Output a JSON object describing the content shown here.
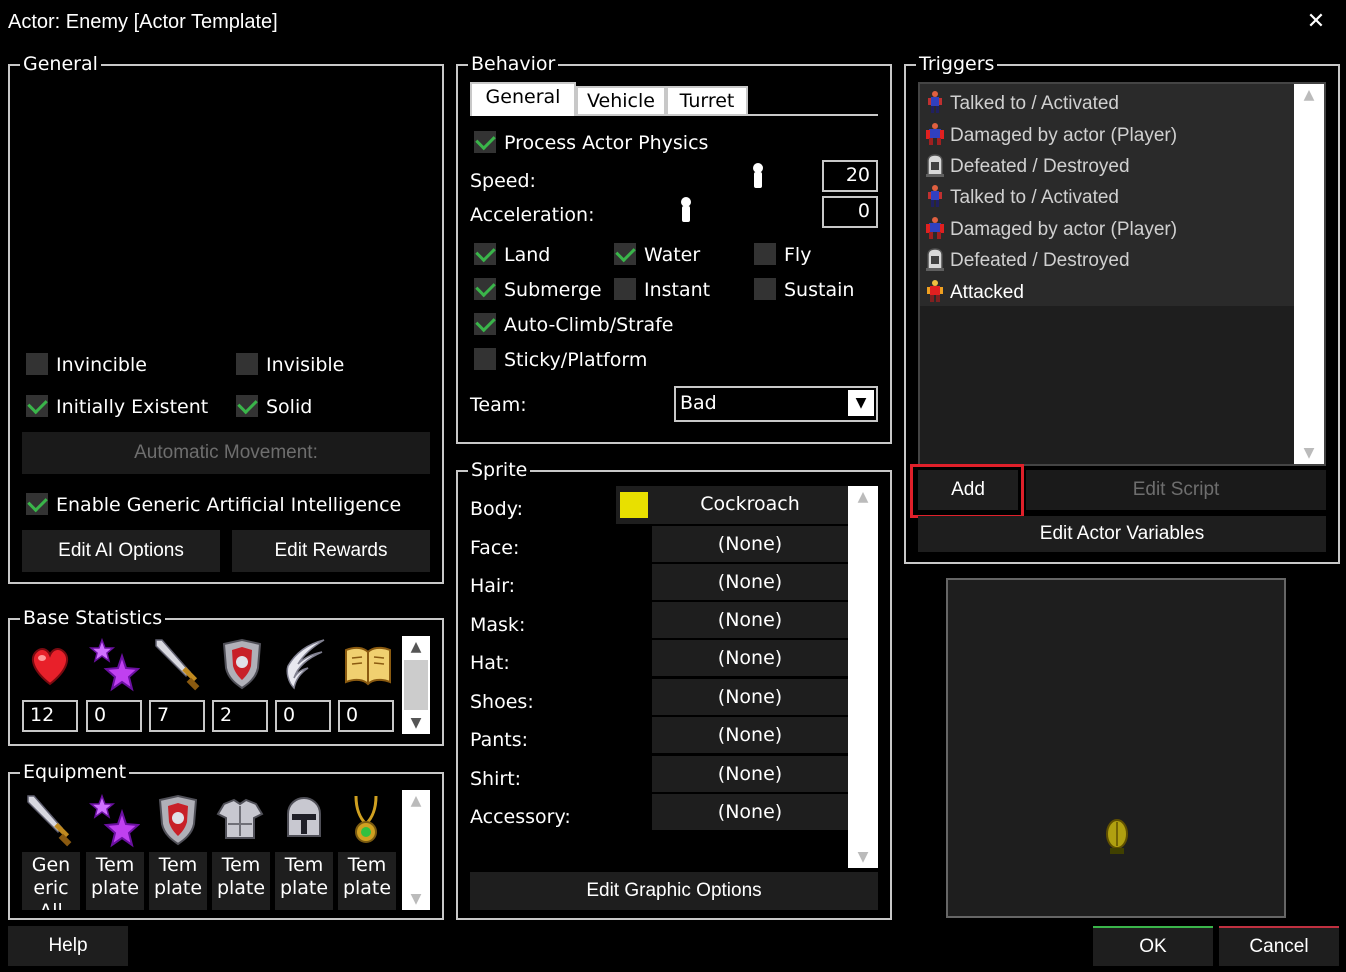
{
  "window": {
    "title": "Actor: Enemy [Actor Template]",
    "close_glyph": "✕"
  },
  "general": {
    "legend": "General",
    "invincible": {
      "label": "Invincible",
      "checked": false
    },
    "invisible": {
      "label": "Invisible",
      "checked": false
    },
    "initially_existent": {
      "label": "Initially Existent",
      "checked": true
    },
    "solid": {
      "label": "Solid",
      "checked": true
    },
    "automatic_movement_label": "Automatic Movement:",
    "enable_ai": {
      "label": "Enable Generic Artificial Intelligence",
      "checked": true
    },
    "edit_ai_options_label": "Edit AI Options",
    "edit_rewards_label": "Edit Rewards"
  },
  "base_statistics": {
    "legend": "Base Statistics",
    "stats": [
      {
        "icon": "heart-icon",
        "value": "12"
      },
      {
        "icon": "magic-stars-icon",
        "value": "0"
      },
      {
        "icon": "sword-icon",
        "value": "7"
      },
      {
        "icon": "shield-icon",
        "value": "2"
      },
      {
        "icon": "wing-icon",
        "value": "0"
      },
      {
        "icon": "book-icon",
        "value": "0"
      }
    ]
  },
  "equipment": {
    "legend": "Equipment",
    "items": [
      {
        "icon": "sword-icon",
        "label": "Gen eric All"
      },
      {
        "icon": "magic-stars-icon",
        "label": "Tem plate"
      },
      {
        "icon": "shield-icon",
        "label": "Tem plate"
      },
      {
        "icon": "armor-icon",
        "label": "Tem plate"
      },
      {
        "icon": "helmet-icon",
        "label": "Tem plate"
      },
      {
        "icon": "amulet-icon",
        "label": "Tem plate"
      }
    ]
  },
  "behavior": {
    "legend": "Behavior",
    "tabs": [
      {
        "label": "General",
        "active": true
      },
      {
        "label": "Vehicle",
        "active": false
      },
      {
        "label": "Turret",
        "active": false
      }
    ],
    "process_physics": {
      "label": "Process Actor Physics",
      "checked": true
    },
    "speed_label": "Speed:",
    "speed_value": "20",
    "acceleration_label": "Acceleration:",
    "acceleration_value": "0",
    "land": {
      "label": "Land",
      "checked": true
    },
    "water": {
      "label": "Water",
      "checked": true
    },
    "fly": {
      "label": "Fly",
      "checked": false
    },
    "submerge": {
      "label": "Submerge",
      "checked": true
    },
    "instant": {
      "label": "Instant",
      "checked": false
    },
    "sustain": {
      "label": "Sustain",
      "checked": false
    },
    "auto_climb": {
      "label": "Auto-Climb/Strafe",
      "checked": true
    },
    "sticky": {
      "label": "Sticky/Platform",
      "checked": false
    },
    "team_label": "Team:",
    "team_value": "Bad",
    "dropdown_glyph": "▼"
  },
  "sprite": {
    "legend": "Sprite",
    "body_color": "#e8e000",
    "slots": [
      {
        "label": "Body:",
        "value": "Cockroach"
      },
      {
        "label": "Face:",
        "value": "(None)"
      },
      {
        "label": "Hair:",
        "value": "(None)"
      },
      {
        "label": "Mask:",
        "value": "(None)"
      },
      {
        "label": "Hat:",
        "value": "(None)"
      },
      {
        "label": "Shoes:",
        "value": "(None)"
      },
      {
        "label": "Pants:",
        "value": "(None)"
      },
      {
        "label": "Shirt:",
        "value": "(None)"
      },
      {
        "label": "Accessory:",
        "value": "(None)"
      }
    ],
    "edit_graphic_options_label": "Edit Graphic Options"
  },
  "triggers": {
    "legend": "Triggers",
    "items": [
      {
        "icon": "actor-talk-icon",
        "label": "Talked to / Activated"
      },
      {
        "icon": "actor-damage-icon",
        "label": "Damaged by actor (Player)"
      },
      {
        "icon": "tombstone-icon",
        "label": "Defeated / Destroyed"
      },
      {
        "icon": "actor-talk-icon",
        "label": "Talked to / Activated"
      },
      {
        "icon": "actor-damage-icon",
        "label": "Damaged by actor (Player)"
      },
      {
        "icon": "tombstone-icon",
        "label": "Defeated / Destroyed"
      },
      {
        "icon": "actor-attacked-icon",
        "label": "Attacked"
      }
    ],
    "add_label": "Add",
    "edit_script_label": "Edit Script",
    "edit_actor_variables_label": "Edit Actor Variables"
  },
  "footer": {
    "help_label": "Help",
    "ok_label": "OK",
    "cancel_label": "Cancel"
  },
  "scroll_glyphs": {
    "up": "▲",
    "down": "▼"
  }
}
